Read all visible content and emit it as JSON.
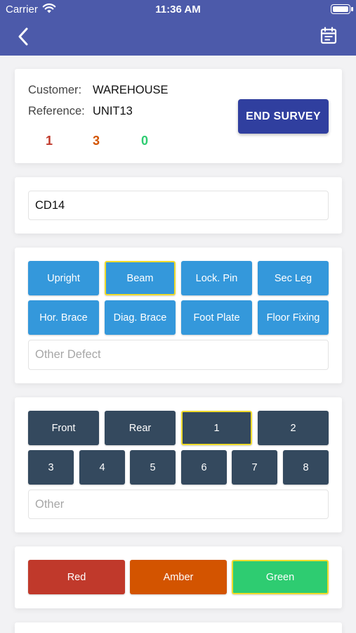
{
  "status_bar": {
    "carrier": "Carrier",
    "time": "11:36 AM"
  },
  "header": {
    "back_icon": "chevron-left-icon",
    "calendar_icon": "calendar-icon"
  },
  "summary": {
    "customer_label": "Customer:",
    "customer_value": "WAREHOUSE",
    "reference_label": "Reference:",
    "reference_value": "UNIT13",
    "counts": {
      "red": "1",
      "amber": "3",
      "green": "0"
    },
    "end_survey_label": "END SURVEY",
    "colors": {
      "red": "#c0392b",
      "amber": "#d35400",
      "green": "#2ecc71"
    }
  },
  "location": {
    "value": "CD14"
  },
  "defect_types": {
    "buttons": [
      "Upright",
      "Beam",
      "Lock. Pin",
      "Sec Leg",
      "Hor. Brace",
      "Diag. Brace",
      "Foot Plate",
      "Floor Fixing"
    ],
    "selected": "Beam",
    "other_placeholder": "Other Defect"
  },
  "positions": {
    "row1": [
      "Front",
      "Rear",
      "1",
      "2"
    ],
    "row2": [
      "3",
      "4",
      "5",
      "6",
      "7",
      "8"
    ],
    "selected": "1",
    "other_placeholder": "Other"
  },
  "severity": {
    "buttons": [
      "Red",
      "Amber",
      "Green"
    ],
    "selected": "Green",
    "colors": {
      "red": "#c0392b",
      "amber": "#d35400",
      "green": "#2ecc71"
    }
  },
  "theme": {
    "header": "#4c5aaa",
    "primary": "#303f9f",
    "blue_button": "#3498db",
    "dark_button": "#34495e",
    "selected_border": "#f0db2b"
  }
}
